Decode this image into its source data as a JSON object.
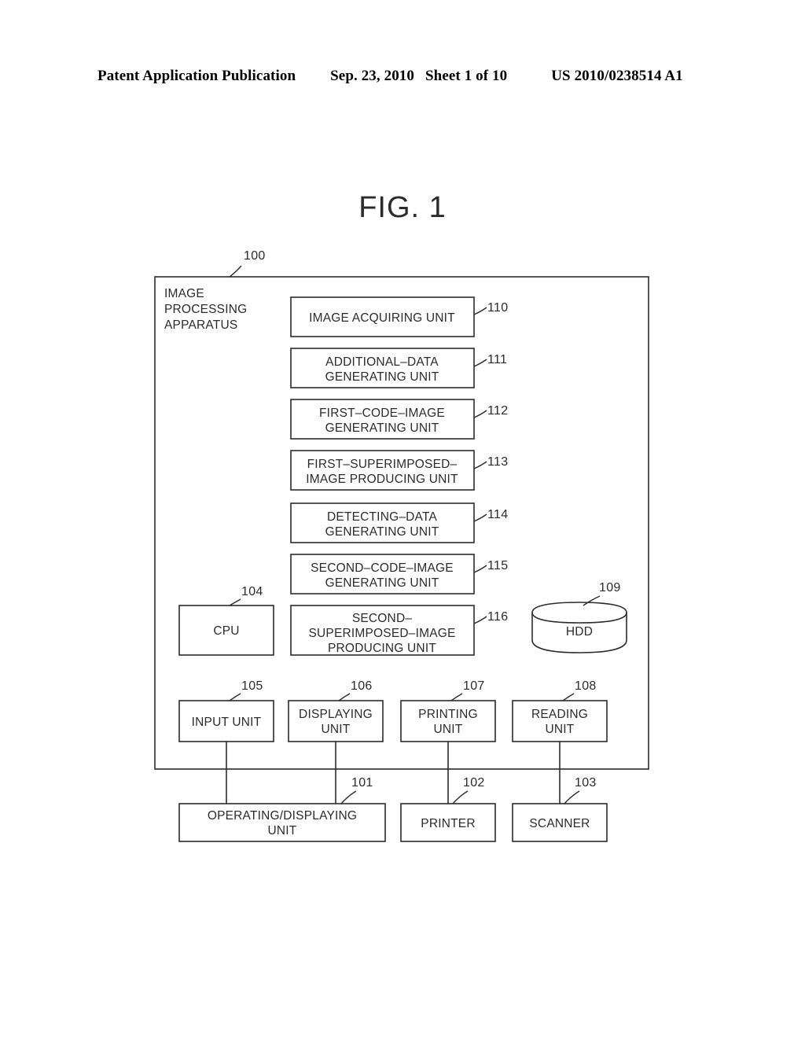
{
  "header": {
    "publication": "Patent Application Publication",
    "date": "Sep. 23, 2010",
    "sheet": "Sheet 1 of 10",
    "patent_number": "US 2010/0238514 A1"
  },
  "figure": {
    "title": "FIG. 1"
  },
  "diagram": {
    "apparatus": {
      "ref": "100",
      "label_line1": "IMAGE",
      "label_line2": "PROCESSING",
      "label_line3": "APPARATUS"
    },
    "units": [
      {
        "ref": "110",
        "line1": "IMAGE ACQUIRING UNIT",
        "line2": "",
        "line3": ""
      },
      {
        "ref": "111",
        "line1": "ADDITIONAL–DATA",
        "line2": "GENERATING UNIT",
        "line3": ""
      },
      {
        "ref": "112",
        "line1": "FIRST–CODE–IMAGE",
        "line2": "GENERATING UNIT",
        "line3": ""
      },
      {
        "ref": "113",
        "line1": "FIRST–SUPERIMPOSED–",
        "line2": "IMAGE PRODUCING UNIT",
        "line3": ""
      },
      {
        "ref": "114",
        "line1": "DETECTING–DATA",
        "line2": "GENERATING UNIT",
        "line3": ""
      },
      {
        "ref": "115",
        "line1": "SECOND–CODE–IMAGE",
        "line2": "GENERATING UNIT",
        "line3": ""
      },
      {
        "ref": "116",
        "line1": "SECOND–",
        "line2": "SUPERIMPOSED–IMAGE",
        "line3": "PRODUCING UNIT"
      }
    ],
    "cpu": {
      "ref": "104",
      "label": "CPU"
    },
    "hdd": {
      "ref": "109",
      "label": "HDD"
    },
    "io_units": [
      {
        "ref": "105",
        "line1": "INPUT UNIT",
        "line2": ""
      },
      {
        "ref": "106",
        "line1": "DISPLAYING",
        "line2": "UNIT"
      },
      {
        "ref": "107",
        "line1": "PRINTING",
        "line2": "UNIT"
      },
      {
        "ref": "108",
        "line1": "READING",
        "line2": "UNIT"
      }
    ],
    "external_devices": [
      {
        "ref": "101",
        "line1": "OPERATING/DISPLAYING",
        "line2": "UNIT"
      },
      {
        "ref": "102",
        "line1": "PRINTER",
        "line2": ""
      },
      {
        "ref": "103",
        "line1": "SCANNER",
        "line2": ""
      }
    ]
  }
}
